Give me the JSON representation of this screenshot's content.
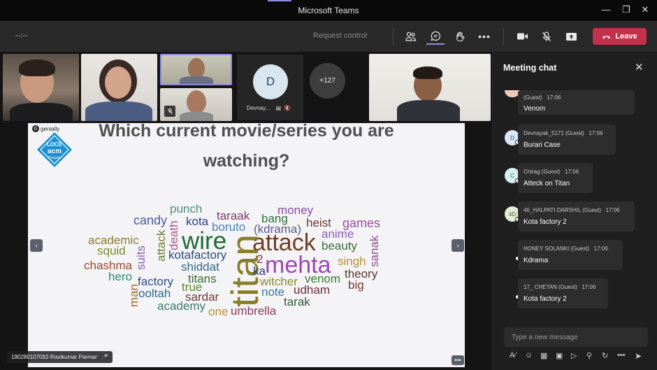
{
  "window": {
    "title": "Microsoft Teams",
    "accent_color": "#8d8de0"
  },
  "toolbar": {
    "timer": "--:--",
    "request_control": "Request control",
    "leave_label": "Leave",
    "leave_color": "#c4314b"
  },
  "participants": {
    "avatar_initial": "D",
    "avatar_name": "Devnay...",
    "overflow_count": "+127"
  },
  "slide": {
    "brand": "genially",
    "logo_lines": [
      "LDCE",
      "acm",
      "Chapter"
    ],
    "question_line1": "Which current movie/series you are",
    "question_line2": "watching?",
    "prev_icon": "chevron-left-icon",
    "next_icon": "chevron-right-icon",
    "presenter_name": "190280107092-Ravikumar Parmar",
    "words": [
      "punch",
      "taraak",
      "money",
      "candy",
      "kota",
      "bang",
      "heist",
      "games",
      "death",
      "boruto",
      "(kdrama)",
      "anime",
      "academic",
      "wire",
      "attack",
      "beauty",
      "sanak",
      "squid",
      "attack",
      "2",
      "mehta",
      "singh",
      "chashma",
      "suits",
      "kotafactory",
      "titan",
      "ka",
      "theory",
      "hero",
      "shiddat",
      "venom",
      "factory",
      "titans",
      "witcher",
      "big",
      "ooltah",
      "true",
      "note",
      "udham",
      "man",
      "sardar",
      "tarak",
      "academy",
      "one",
      "umbrella"
    ]
  },
  "chat": {
    "title": "Meeting chat",
    "compose_placeholder": "Type a new message",
    "messages": [
      {
        "sender": "(Guest)",
        "time": "17:06",
        "text": "Venom",
        "initials": ""
      },
      {
        "sender": "Devnayak_5171 (Guest)",
        "time": "17:06",
        "text": "Burari Case",
        "initials": "D"
      },
      {
        "sender": "Chirag (Guest)",
        "time": "17:06",
        "text": "Atteck on Titan",
        "initials": "C"
      },
      {
        "sender": "46_HALPATI DARSHIL (Guest)",
        "time": "17:06",
        "text": "Kota factory 2",
        "initials": "4D"
      },
      {
        "sender": "HONEY SOLANKI (Guest)",
        "time": "17:06",
        "text": "Kdrama",
        "initials": ""
      },
      {
        "sender": "17_ CHETAN (Guest)",
        "time": "17:06",
        "text": "Kota factory 2",
        "initials": ""
      }
    ]
  }
}
